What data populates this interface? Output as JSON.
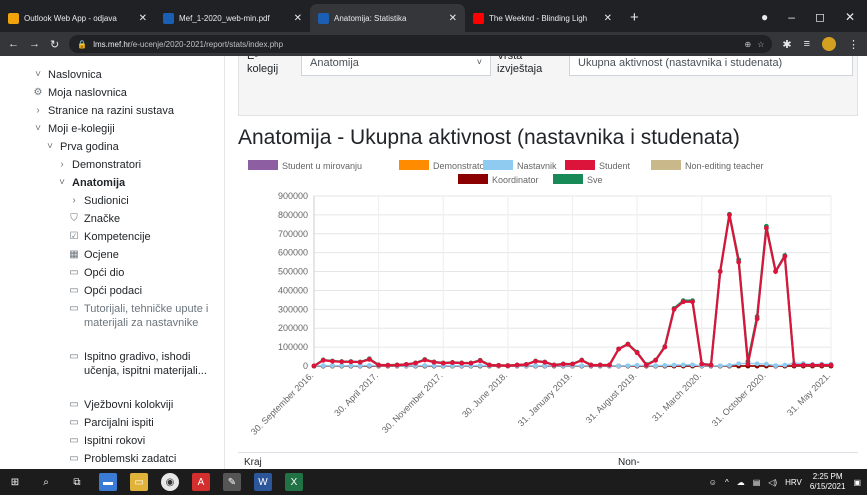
{
  "browser": {
    "tabs": [
      {
        "title": "Outlook Web App - odjava",
        "fav_color": "#f0a30a",
        "active": false
      },
      {
        "title": "Mef_1-2020_web-min.pdf",
        "fav_color": "#1a5fb4",
        "fav_text": "mf",
        "active": false
      },
      {
        "title": "Anatomija: Statistika",
        "fav_color": "#1a5fb4",
        "fav_text": "mf",
        "active": true
      },
      {
        "title": "The Weeknd - Blinding Ligh",
        "fav_color": "#ff0000",
        "active": false
      }
    ],
    "new_tab": "+",
    "url_host": "lms.mef.hr",
    "url_path": "/e-ucenje/2020-2021/report/stats/index.php"
  },
  "sidebar": {
    "items": [
      {
        "label": "Naslovnica",
        "icon": "chevron-down-icon",
        "glyph": "˅"
      },
      {
        "label": "Moja naslovnica",
        "icon": "dashboard-icon",
        "glyph": "⚙"
      },
      {
        "label": "Stranice na razini sustava",
        "icon": "chevron-right-icon",
        "glyph": "›"
      },
      {
        "label": "Moji e-kolegiji",
        "icon": "chevron-down-icon",
        "glyph": "˅"
      },
      {
        "label": "Prva godina",
        "icon": "chevron-down-icon",
        "glyph": "˅"
      },
      {
        "label": "Demonstratori",
        "icon": "chevron-right-icon",
        "glyph": "›"
      },
      {
        "label": "Anatomija",
        "icon": "chevron-down-icon",
        "glyph": "˅"
      },
      {
        "label": "Sudionici",
        "icon": "chevron-right-icon",
        "glyph": "›"
      },
      {
        "label": "Značke",
        "icon": "shield-icon",
        "glyph": "⛉"
      },
      {
        "label": "Kompetencije",
        "icon": "checkbox-icon",
        "glyph": "☑"
      },
      {
        "label": "Ocjene",
        "icon": "table-icon",
        "glyph": "▦"
      },
      {
        "label": "Opći dio",
        "icon": "folder-icon",
        "glyph": "▭"
      },
      {
        "label": "Opći podaci",
        "icon": "folder-icon",
        "glyph": "▭"
      },
      {
        "label": "Tutorijali, tehničke upute i materijali za nastavnike",
        "icon": "folder-icon",
        "glyph": "▭"
      },
      {
        "label": "Ispitno gradivo, ishodi učenja, ispitni materijali...",
        "icon": "folder-icon",
        "glyph": "▭"
      },
      {
        "label": "Vježbovni kolokviji",
        "icon": "folder-icon",
        "glyph": "▭"
      },
      {
        "label": "Parcijalni ispiti",
        "icon": "folder-icon",
        "glyph": "▭"
      },
      {
        "label": "Ispitni rokovi",
        "icon": "folder-icon",
        "glyph": "▭"
      },
      {
        "label": "Problemski zadatci",
        "icon": "folder-icon",
        "glyph": "▭"
      }
    ]
  },
  "filters": {
    "course_label": "E-kolegij",
    "course_value": "Anatomija",
    "report_label": "Vrsta izvještaja",
    "report_value": "Ukupna aktivnost (nastavnika i studenata)"
  },
  "page_title": "Anatomija - Ukupna aktivnost (nastavnika i studenata)",
  "bottom": {
    "col1": "Kraj",
    "col2": "Non-"
  },
  "taskbar": {
    "lang": "HRV",
    "time": "2:25 PM",
    "date": "6/15/2021"
  },
  "chart_data": {
    "type": "line",
    "title": "",
    "ylim": [
      0,
      900000
    ],
    "yticks": [
      0,
      100000,
      200000,
      300000,
      400000,
      500000,
      600000,
      700000,
      800000,
      900000
    ],
    "xtick_labels": [
      "30. September 2016.",
      "30. April 2017.",
      "30. November 2017.",
      "30. June 2018.",
      "31. January 2019.",
      "31. August 2019.",
      "31. March 2020.",
      "31. October 2020.",
      "31. May 2021."
    ],
    "series": [
      {
        "name": "Student u mirovanju",
        "color": "#8e5ea2",
        "values": [
          0,
          0,
          0,
          0,
          0,
          0,
          0,
          0,
          0,
          0,
          0,
          0,
          0,
          0,
          0,
          0,
          0,
          0,
          0,
          0,
          0,
          0,
          0,
          0,
          0,
          0,
          0,
          0,
          0,
          0,
          0,
          0,
          0,
          0,
          0,
          0,
          0,
          0,
          0,
          0,
          0,
          0,
          0,
          0,
          0,
          0,
          0,
          0,
          0,
          0,
          0,
          0,
          0,
          0,
          0,
          0,
          0
        ]
      },
      {
        "name": "Demonstrator",
        "color": "#ff8c00",
        "values": [
          0,
          0,
          0,
          0,
          0,
          0,
          0,
          0,
          0,
          0,
          0,
          0,
          0,
          0,
          0,
          0,
          0,
          0,
          0,
          0,
          0,
          0,
          0,
          0,
          0,
          0,
          0,
          0,
          0,
          0,
          0,
          0,
          0,
          0,
          0,
          0,
          0,
          0,
          0,
          0,
          0,
          0,
          0,
          0,
          0,
          0,
          0,
          0,
          0,
          0,
          0,
          0,
          0,
          0,
          0,
          0,
          0
        ]
      },
      {
        "name": "Nastavnik",
        "color": "#8fcbf0",
        "values": [
          0,
          2000,
          1500,
          1500,
          1500,
          1200,
          3000,
          800,
          800,
          600,
          700,
          1500,
          2500,
          1500,
          1000,
          1000,
          1200,
          1000,
          2500,
          800,
          700,
          600,
          500,
          600,
          1500,
          1000,
          800,
          800,
          1000,
          1500,
          800,
          500,
          400,
          500,
          1500,
          3000,
          2500,
          1500,
          3000,
          5000,
          6000,
          6000,
          1000,
          1000,
          1500,
          3000,
          12000,
          15000,
          12000,
          10000,
          2000,
          5000,
          15000,
          13000,
          8000,
          10000,
          9000
        ]
      },
      {
        "name": "Student",
        "color": "#dc143c",
        "values": [
          0,
          30000,
          25000,
          22000,
          22000,
          20000,
          35000,
          5000,
          4000,
          5000,
          8000,
          15000,
          32000,
          20000,
          15000,
          18000,
          15000,
          15000,
          28000,
          5000,
          3000,
          2000,
          5000,
          8000,
          25000,
          20000,
          5000,
          10000,
          10000,
          30000,
          5000,
          5000,
          5000,
          90000,
          115000,
          70000,
          5000,
          30000,
          100000,
          300000,
          340000,
          340000,
          10000,
          5000,
          500000,
          800000,
          550000,
          10000,
          250000,
          730000,
          500000,
          580000,
          5000,
          5000,
          5000,
          5000,
          5000
        ]
      },
      {
        "name": "Non-editing teacher",
        "color": "#c8b88a",
        "values": [
          0,
          0,
          0,
          0,
          0,
          0,
          0,
          0,
          0,
          0,
          0,
          0,
          0,
          0,
          0,
          0,
          0,
          0,
          0,
          0,
          0,
          0,
          0,
          0,
          0,
          0,
          0,
          0,
          0,
          0,
          0,
          0,
          0,
          0,
          0,
          0,
          0,
          0,
          0,
          0,
          0,
          0,
          0,
          0,
          0,
          0,
          0,
          0,
          0,
          0,
          0,
          0,
          0,
          0,
          0,
          0,
          0
        ]
      },
      {
        "name": "Koordinator",
        "color": "#8b0000",
        "values": [
          0,
          0,
          0,
          0,
          0,
          0,
          0,
          0,
          0,
          0,
          0,
          0,
          0,
          0,
          0,
          0,
          0,
          0,
          0,
          0,
          0,
          0,
          0,
          0,
          0,
          0,
          0,
          0,
          0,
          0,
          0,
          0,
          0,
          0,
          0,
          0,
          0,
          0,
          0,
          0,
          0,
          0,
          0,
          0,
          0,
          0,
          0,
          0,
          0,
          0,
          0,
          0,
          0,
          0,
          0,
          0,
          0
        ]
      },
      {
        "name": "Sve",
        "color": "#178a57",
        "values": [
          0,
          32000,
          26500,
          23500,
          23500,
          21200,
          38000,
          5800,
          4800,
          5600,
          8700,
          16500,
          34500,
          21500,
          16000,
          19000,
          16200,
          16000,
          30500,
          5800,
          3700,
          2600,
          5500,
          8600,
          26500,
          21000,
          5800,
          10800,
          11000,
          31500,
          5800,
          5500,
          5400,
          90500,
          116500,
          73000,
          7500,
          31500,
          103000,
          305000,
          346000,
          346000,
          11000,
          6000,
          501500,
          803000,
          562000,
          25000,
          262000,
          740000,
          502000,
          585000,
          5000,
          5000,
          5000,
          5000,
          5000
        ]
      }
    ]
  }
}
